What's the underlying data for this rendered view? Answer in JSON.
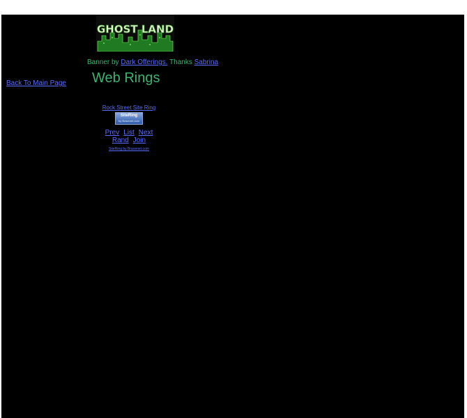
{
  "banner": {
    "logo_text": "GHOST LAND",
    "credit_prefix": "Banner by",
    "credit_link": "Dark Offerings.",
    "thanks": "Thanks",
    "thanks_link": "Sabrina"
  },
  "nav": {
    "back_label": "Back  To Main Page"
  },
  "main": {
    "title": "Web Rings"
  },
  "ring": {
    "name": "Rock Street Site Ring",
    "logo_title": "SiteRing",
    "logo_sub": "by Bravenet.com",
    "prev": "Prev",
    "list": "List",
    "next": "Next",
    "rand": "Rand",
    "join": "Join",
    "credit": "SiteRing by Bravenet.com"
  },
  "colors": {
    "page_background": "#000000",
    "text_green": "#3cb371",
    "link_blue": "#5a6cff"
  }
}
